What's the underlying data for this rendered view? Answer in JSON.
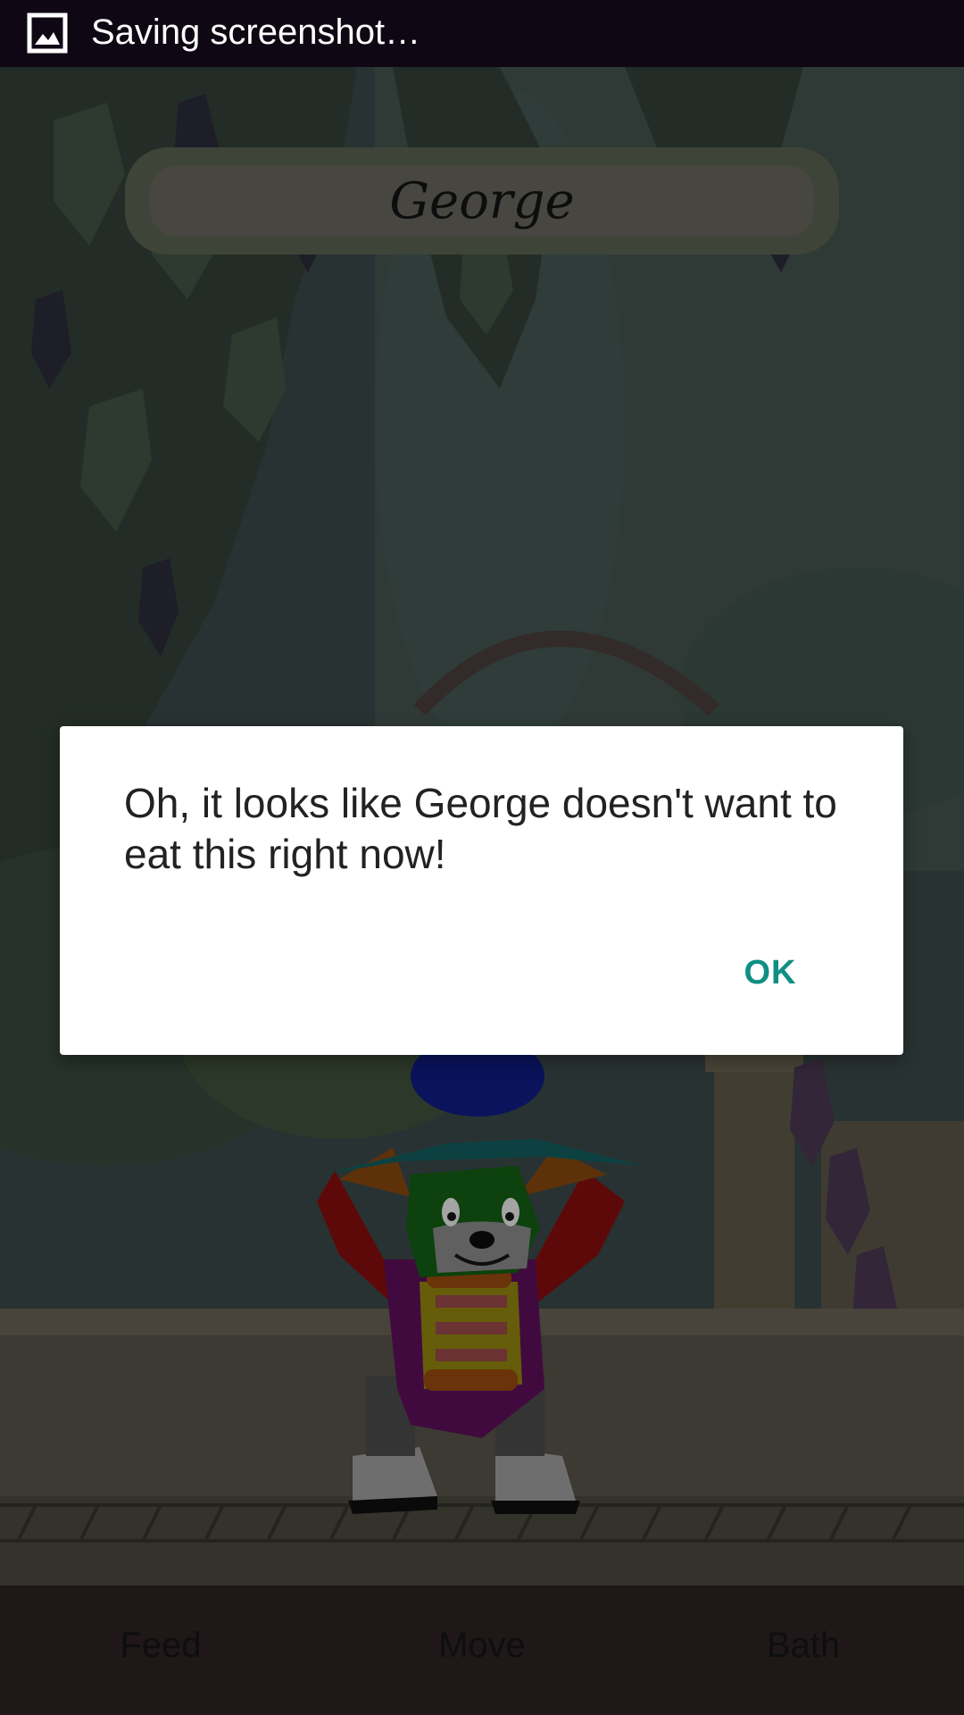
{
  "status_bar": {
    "icon": "image-icon",
    "text": "Saving screenshot…"
  },
  "pet": {
    "name": "George"
  },
  "dialog": {
    "message": "Oh, it looks like George doesn't want to eat this right now!",
    "ok_label": "OK",
    "accent": "#0f8f84"
  },
  "bottom_nav": {
    "items": [
      {
        "label": "Feed"
      },
      {
        "label": "Move"
      },
      {
        "label": "Bath"
      }
    ]
  }
}
